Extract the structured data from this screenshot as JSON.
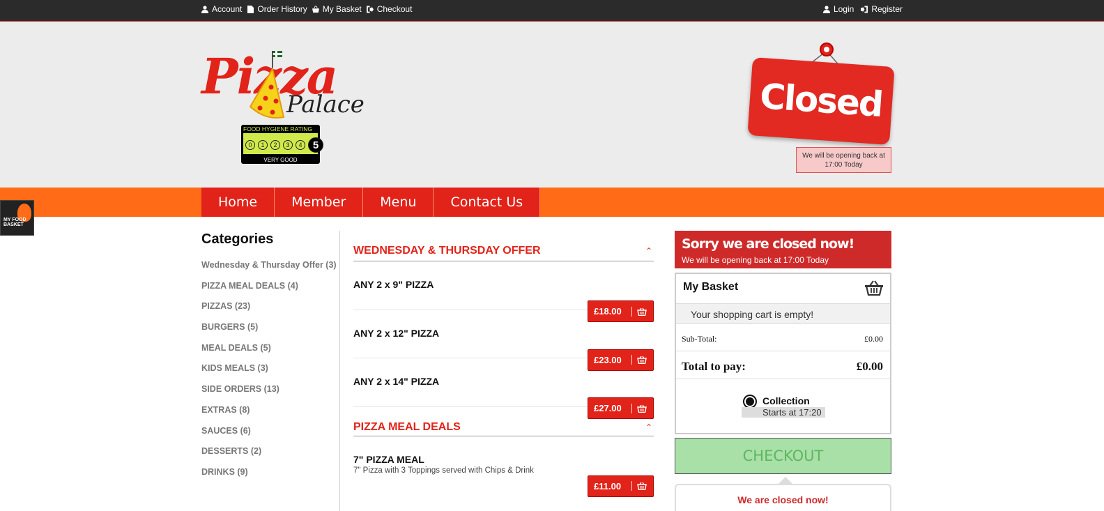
{
  "topbar": {
    "left_links": [
      {
        "label": "Account",
        "icon": "user-icon"
      },
      {
        "label": "Order History",
        "icon": "document-icon"
      },
      {
        "label": "My Basket",
        "icon": "basket-icon"
      },
      {
        "label": "Checkout",
        "icon": "signout-icon"
      }
    ],
    "right_links": [
      {
        "label": "Login",
        "icon": "user-icon"
      },
      {
        "label": "Register",
        "icon": "signin-icon"
      }
    ]
  },
  "header": {
    "logo_word1": "Pizza",
    "logo_word2": "Palace",
    "hygiene": {
      "title": "FOOD HYGIENE RATING",
      "label": "VERY GOOD",
      "scores": [
        "0",
        "1",
        "2",
        "3",
        "4",
        "5"
      ],
      "rating": "5"
    },
    "closed_sign": "Closed",
    "opening_notice": "We will be opening back at 17:00 Today"
  },
  "nav": [
    "Home",
    "Member",
    "Menu",
    "Contact Us"
  ],
  "badge_text": "MY FOOD BASKET",
  "categories": {
    "title": "Categories",
    "items": [
      "Wednesday & Thursday Offer (3)",
      "PIZZA MEAL DEALS (4)",
      "PIZZAS (23)",
      "BURGERS (5)",
      "MEAL DEALS (5)",
      "KIDS MEALS (3)",
      "SIDE ORDERS (13)",
      "EXTRAS (8)",
      "SAUCES (6)",
      "DESSERTS (2)",
      "DRINKS (9)"
    ]
  },
  "menu": {
    "sections": [
      {
        "title": "WEDNESDAY & THURSDAY OFFER",
        "items": [
          {
            "name": "ANY 2 x 9\" PIZZA",
            "desc": "",
            "price": "£18.00"
          },
          {
            "name": "ANY 2 x 12\" PIZZA",
            "desc": "",
            "price": "£23.00"
          },
          {
            "name": "ANY 2 x 14\" PIZZA",
            "desc": "",
            "price": "£27.00"
          }
        ]
      },
      {
        "title": "PIZZA MEAL DEALS",
        "items": [
          {
            "name": "7\" PIZZA MEAL",
            "desc": "7\" Pizza with 3 Toppings served with Chips & Drink",
            "price": "£11.00"
          }
        ]
      }
    ]
  },
  "sidebar": {
    "closed_title": "Sorry we are closed now!",
    "closed_sub": "We will be opening back at 17:00 Today",
    "basket_title": "My Basket",
    "empty_msg": "Your shopping cart is empty!",
    "subtotal_label": "Sub-Total:",
    "subtotal_value": "£0.00",
    "total_label": "Total to pay:",
    "total_value": "£0.00",
    "collection_label": "Collection",
    "collection_starts": "Starts at 17:20",
    "checkout_label": "CHECKOUT",
    "closed_now": "We are closed now!"
  },
  "colors": {
    "brand_red": "#e2231a",
    "nav_orange": "#ff6b16",
    "checkout_green": "#a8e0a8"
  }
}
